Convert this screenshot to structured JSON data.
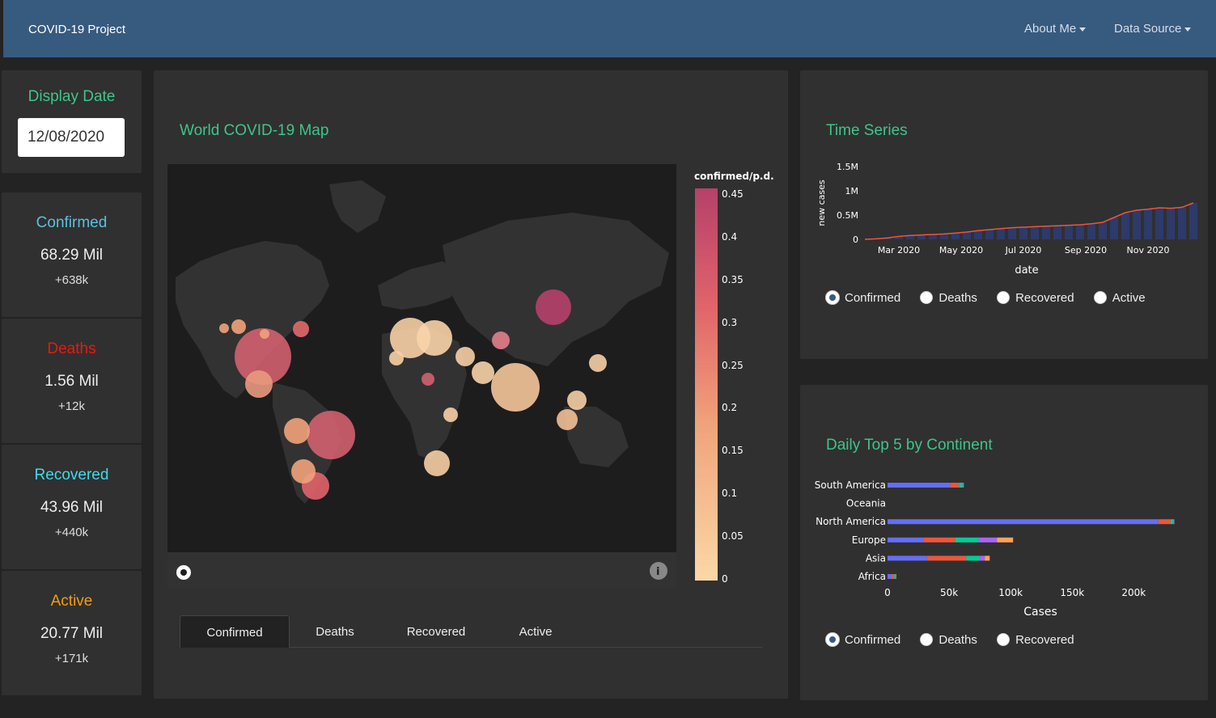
{
  "navbar": {
    "brand": "COVID-19 Project",
    "items": [
      {
        "label": "About Me"
      },
      {
        "label": "Data Source"
      }
    ],
    "color": "#375a7f"
  },
  "date_panel": {
    "title": "Display Date",
    "value": "12/08/2020"
  },
  "stats": [
    {
      "title": "Confirmed",
      "value": "68.29 Mil",
      "delta": "+638k",
      "color": "#5bc0de"
    },
    {
      "title": "Deaths",
      "value": "1.56 Mil",
      "delta": "+12k",
      "color": "#e8190f"
    },
    {
      "title": "Recovered",
      "value": "43.96 Mil",
      "delta": "+440k",
      "color": "#3ddbe8"
    },
    {
      "title": "Active",
      "value": "20.77 Mil",
      "delta": "+171k",
      "color": "#f39c12"
    }
  ],
  "map_panel": {
    "title": "World COVID-19 Map",
    "colorbar": {
      "title": "confirmed/p.d.",
      "ticks": [
        "0.45",
        "0.4",
        "0.35",
        "0.3",
        "0.25",
        "0.2",
        "0.15",
        "0.1",
        "0.05",
        "0"
      ]
    },
    "tabs": [
      {
        "label": "Confirmed"
      },
      {
        "label": "Deaths"
      },
      {
        "label": "Recovered"
      },
      {
        "label": "Active"
      }
    ],
    "active_tab": "Confirmed"
  },
  "time_series": {
    "title": "Time Series",
    "radios": [
      {
        "label": "Confirmed",
        "selected": true
      },
      {
        "label": "Deaths",
        "selected": false
      },
      {
        "label": "Recovered",
        "selected": false
      },
      {
        "label": "Active",
        "selected": false
      }
    ]
  },
  "top5": {
    "title": "Daily Top 5 by Continent",
    "radios": [
      {
        "label": "Confirmed",
        "selected": true
      },
      {
        "label": "Deaths",
        "selected": false
      },
      {
        "label": "Recovered",
        "selected": false
      }
    ]
  },
  "chart_data": [
    {
      "type": "line",
      "xlabel": "date",
      "ylabel": "new cases",
      "x_ticks": [
        "Mar 2020",
        "May 2020",
        "Jul 2020",
        "Sep 2020",
        "Nov 2020"
      ],
      "y_ticks": [
        "0",
        "0.5M",
        "1M",
        "1.5M"
      ],
      "ylim": [
        0,
        1500000
      ],
      "series": [
        {
          "values": [
            0,
            10000,
            30000,
            60000,
            80000,
            90000,
            100000,
            110000,
            130000,
            150000,
            180000,
            200000,
            220000,
            240000,
            250000,
            260000,
            270000,
            280000,
            290000,
            300000,
            320000,
            350000,
            450000,
            550000,
            600000,
            620000,
            650000,
            640000,
            660000,
            750000
          ]
        }
      ]
    },
    {
      "type": "bar",
      "orientation": "horizontal",
      "stacked": true,
      "xlabel": "Cases",
      "categories": [
        "South America",
        "Oceania",
        "North America",
        "Europe",
        "Asia",
        "Africa"
      ],
      "x_ticks": [
        "0",
        "50k",
        "100k",
        "150k",
        "200k"
      ],
      "xlim": [
        0,
        240000
      ],
      "series": [
        {
          "color": "#636efa",
          "values": [
            51000,
            0,
            220000,
            29000,
            32000,
            3000
          ]
        },
        {
          "color": "#ef553b",
          "values": [
            7000,
            0,
            10000,
            26000,
            32000,
            2000
          ]
        },
        {
          "color": "#00cc96",
          "values": [
            3000,
            0,
            2000,
            19000,
            11000,
            1000
          ]
        },
        {
          "color": "#ab63fa",
          "values": [
            1000,
            0,
            1000,
            15000,
            4000,
            500
          ]
        },
        {
          "color": "#ffa15a",
          "values": [
            0,
            0,
            0,
            13000,
            4000,
            500
          ]
        }
      ]
    }
  ]
}
